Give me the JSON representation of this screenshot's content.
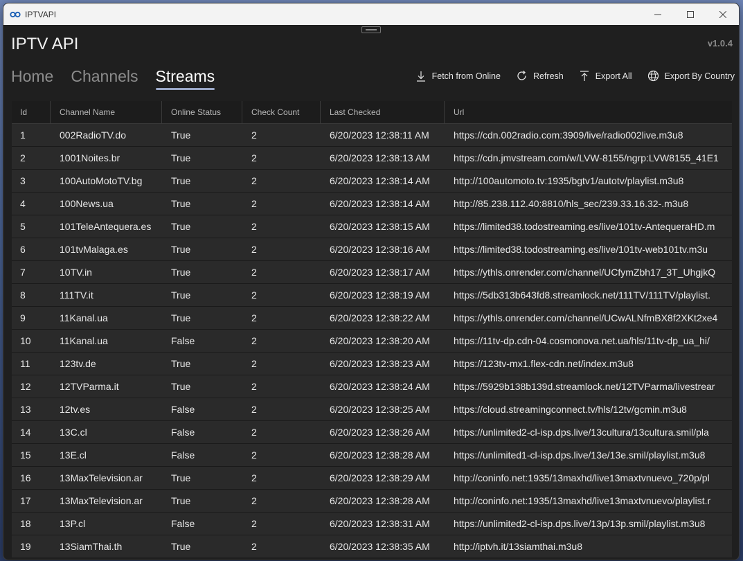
{
  "window": {
    "app_title": "IPTVAPI"
  },
  "header": {
    "app_name": "IPTV API",
    "version": "v1.0.4"
  },
  "nav": [
    {
      "label": "Home",
      "active": false
    },
    {
      "label": "Channels",
      "active": false
    },
    {
      "label": "Streams",
      "active": true
    }
  ],
  "toolbar": {
    "fetch_label": "Fetch from Online",
    "refresh_label": "Refresh",
    "export_all_label": "Export All",
    "export_country_label": "Export By Country"
  },
  "table": {
    "columns": [
      "Id",
      "Channel Name",
      "Online Status",
      "Check Count",
      "Last Checked",
      "Url"
    ],
    "rows": [
      [
        "1",
        "002RadioTV.do",
        "True",
        "2",
        "6/20/2023 12:38:11 AM",
        "https://cdn.002radio.com:3909/live/radio002live.m3u8"
      ],
      [
        "2",
        "1001Noites.br",
        "True",
        "2",
        "6/20/2023 12:38:13 AM",
        "https://cdn.jmvstream.com/w/LVW-8155/ngrp:LVW8155_41E1"
      ],
      [
        "3",
        "100AutoMotoTV.bg",
        "True",
        "2",
        "6/20/2023 12:38:14 AM",
        "http://100automoto.tv:1935/bgtv1/autotv/playlist.m3u8"
      ],
      [
        "4",
        "100News.ua",
        "True",
        "2",
        "6/20/2023 12:38:14 AM",
        "http://85.238.112.40:8810/hls_sec/239.33.16.32-.m3u8"
      ],
      [
        "5",
        "101TeleAntequera.es",
        "True",
        "2",
        "6/20/2023 12:38:15 AM",
        "https://limited38.todostreaming.es/live/101tv-AntequeraHD.m"
      ],
      [
        "6",
        "101tvMalaga.es",
        "True",
        "2",
        "6/20/2023 12:38:16 AM",
        "https://limited38.todostreaming.es/live/101tv-web101tv.m3u"
      ],
      [
        "7",
        "10TV.in",
        "True",
        "2",
        "6/20/2023 12:38:17 AM",
        "https://ythls.onrender.com/channel/UCfymZbh17_3T_UhgjkQ"
      ],
      [
        "8",
        "111TV.it",
        "True",
        "2",
        "6/20/2023 12:38:19 AM",
        "https://5db313b643fd8.streamlock.net/111TV/111TV/playlist."
      ],
      [
        "9",
        "11Kanal.ua",
        "True",
        "2",
        "6/20/2023 12:38:22 AM",
        "https://ythls.onrender.com/channel/UCwALNfmBX8f2XKt2xe4"
      ],
      [
        "10",
        "11Kanal.ua",
        "False",
        "2",
        "6/20/2023 12:38:20 AM",
        "https://11tv-dp.cdn-04.cosmonova.net.ua/hls/11tv-dp_ua_hi/"
      ],
      [
        "11",
        "123tv.de",
        "True",
        "2",
        "6/20/2023 12:38:23 AM",
        "https://123tv-mx1.flex-cdn.net/index.m3u8"
      ],
      [
        "12",
        "12TVParma.it",
        "True",
        "2",
        "6/20/2023 12:38:24 AM",
        "https://5929b138b139d.streamlock.net/12TVParma/livestrear"
      ],
      [
        "13",
        "12tv.es",
        "False",
        "2",
        "6/20/2023 12:38:25 AM",
        "https://cloud.streamingconnect.tv/hls/12tv/gcmin.m3u8"
      ],
      [
        "14",
        "13C.cl",
        "False",
        "2",
        "6/20/2023 12:38:26 AM",
        "https://unlimited2-cl-isp.dps.live/13cultura/13cultura.smil/pla"
      ],
      [
        "15",
        "13E.cl",
        "False",
        "2",
        "6/20/2023 12:38:28 AM",
        "https://unlimited1-cl-isp.dps.live/13e/13e.smil/playlist.m3u8"
      ],
      [
        "16",
        "13MaxTelevision.ar",
        "True",
        "2",
        "6/20/2023 12:38:29 AM",
        "http://coninfo.net:1935/13maxhd/live13maxtvnuevo_720p/pl"
      ],
      [
        "17",
        "13MaxTelevision.ar",
        "True",
        "2",
        "6/20/2023 12:38:28 AM",
        "http://coninfo.net:1935/13maxhd/live13maxtvnuevo/playlist.r"
      ],
      [
        "18",
        "13P.cl",
        "False",
        "2",
        "6/20/2023 12:38:31 AM",
        "https://unlimited2-cl-isp.dps.live/13p/13p.smil/playlist.m3u8"
      ],
      [
        "19",
        "13SiamThai.th",
        "True",
        "2",
        "6/20/2023 12:38:35 AM",
        "http://iptvh.it/13siamthai.m3u8"
      ]
    ]
  }
}
